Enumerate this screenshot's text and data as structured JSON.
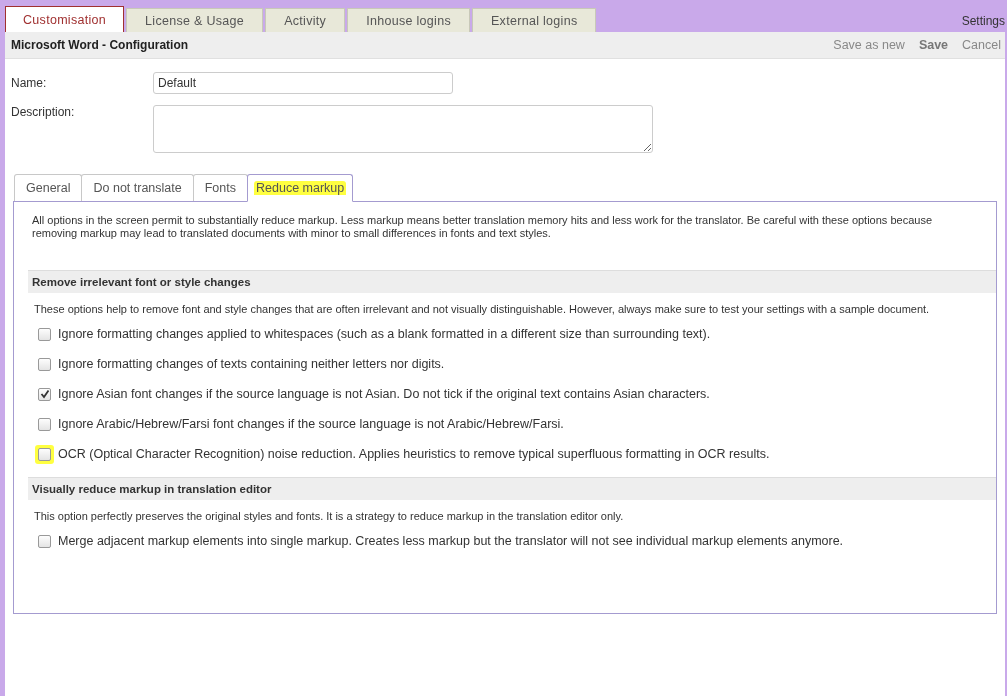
{
  "top_tabs": [
    {
      "label": "Customisation",
      "selected": true
    },
    {
      "label": "License & Usage",
      "selected": false
    },
    {
      "label": "Activity",
      "selected": false
    },
    {
      "label": "Inhouse logins",
      "selected": false
    },
    {
      "label": "External logins",
      "selected": false
    }
  ],
  "settings_label": "Settings",
  "header": {
    "title": "Microsoft Word - Configuration",
    "actions": [
      {
        "label": "Save as new",
        "kind": "link"
      },
      {
        "label": "Save",
        "kind": "primary"
      },
      {
        "label": "Cancel",
        "kind": "link"
      }
    ]
  },
  "form": {
    "name": {
      "label": "Name:",
      "value": "Default"
    },
    "description": {
      "label": "Description:"
    }
  },
  "inner_tabs": [
    {
      "label": "General",
      "selected": false,
      "highlighted": false
    },
    {
      "label": "Do not translate",
      "selected": false,
      "highlighted": false
    },
    {
      "label": "Fonts",
      "selected": false,
      "highlighted": false
    },
    {
      "label": "Reduce markup",
      "selected": true,
      "highlighted": true
    }
  ],
  "intro": "All options in the screen permit to substantially reduce markup. Less markup means better translation memory hits and less work for the translator. Be careful with these options because removing markup may lead to translated documents with minor to small differences in fonts and text styles.",
  "sections": [
    {
      "title": "Remove irrelevant font or style changes",
      "note": "These options help to remove font and style changes that are often irrelevant and not visually distinguishable. However, always make sure to test your settings with a sample document.",
      "groups": [
        [
          {
            "label": "Ignore formatting changes applied to whitespaces (such as a blank formatted in a different size than surrounding text).",
            "checked": false,
            "highlighted": false
          },
          {
            "label": "Ignore formatting changes of texts containing neither letters nor digits.",
            "checked": false,
            "highlighted": false
          }
        ],
        [
          {
            "label": "Ignore Asian font changes if the source language is not Asian. Do not tick if the original text contains Asian characters.",
            "checked": true,
            "highlighted": false
          },
          {
            "label": "Ignore Arabic/Hebrew/Farsi font changes if the source language is not Arabic/Hebrew/Farsi.",
            "checked": false,
            "highlighted": false
          }
        ],
        [
          {
            "label": "OCR (Optical Character Recognition) noise reduction. Applies heuristics to remove typical superfluous formatting in OCR results.",
            "checked": false,
            "highlighted": true
          }
        ]
      ]
    },
    {
      "title": "Visually reduce markup in translation editor",
      "note": "This option perfectly preserves the original styles and fonts. It is a strategy to reduce markup in the translation editor only.",
      "groups": [
        [
          {
            "label": "Merge adjacent markup elements into single markup. Creates less markup but the translator will not see individual markup elements anymore.",
            "checked": false,
            "highlighted": false
          }
        ]
      ]
    }
  ]
}
